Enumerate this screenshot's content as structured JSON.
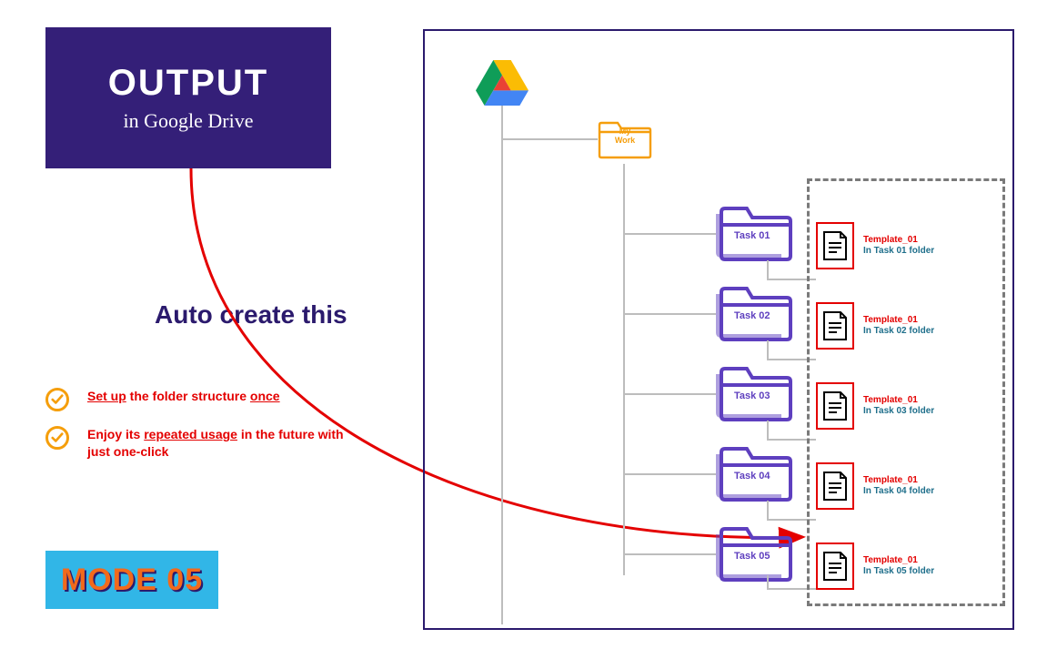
{
  "header": {
    "title": "OUTPUT",
    "subtitle": "in Google Drive"
  },
  "tagline": "Auto create this",
  "checklist": [
    {
      "parts": [
        "<u>Set up</u> the folder structure <u>once</u>"
      ]
    },
    {
      "parts": [
        "Enjoy its <u>repeated usage</u> in the future with just one-click"
      ]
    }
  ],
  "mode_badge": "MODE 05",
  "tree": {
    "root_folder": {
      "line1": "My",
      "line2": "Work"
    },
    "tasks": [
      "Task 01",
      "Task 02",
      "Task 03",
      "Task 04",
      "Task 05"
    ],
    "templates": [
      {
        "name": "Template_01",
        "location": "In Task 01 folder"
      },
      {
        "name": "Template_01",
        "location": "In Task 02 folder"
      },
      {
        "name": "Template_01",
        "location": "In Task 03 folder"
      },
      {
        "name": "Template_01",
        "location": "In Task 04 folder"
      },
      {
        "name": "Template_01",
        "location": "In Task 05 folder"
      }
    ]
  },
  "icons": {
    "drive": "google-drive-icon",
    "check": "check-icon",
    "folder_orange": "folder-icon",
    "folder_purple": "folder-icon",
    "document": "document-icon"
  },
  "colors": {
    "purple": "#341f78",
    "folder_purple": "#5e3fbf",
    "orange": "#f59e0b",
    "red": "#e40000",
    "teal": "#1f6f8b",
    "badge_bg": "#31b6e7",
    "badge_text": "#f26a1b"
  }
}
